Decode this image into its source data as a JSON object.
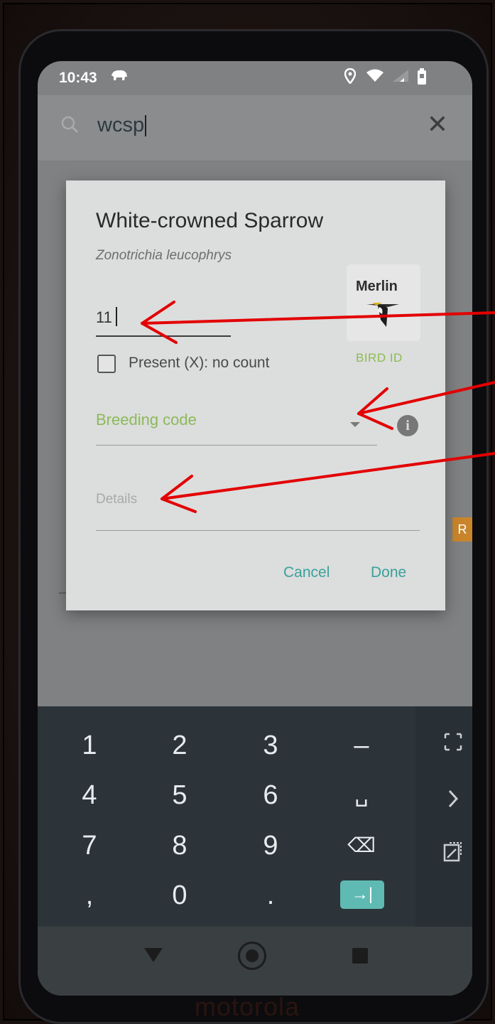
{
  "status_bar": {
    "time": "10:43"
  },
  "search": {
    "query": "wcsp"
  },
  "dialog": {
    "common_name": "White-crowned Sparrow",
    "scientific_name": "Zonotrichia leucophrys",
    "count_value": "11",
    "present_label": "Present (X): no count",
    "breeding_code_label": "Breeding code",
    "details_placeholder": "Details",
    "merlin_logo_text": "Merlin",
    "merlin_link_label": "BIRD ID",
    "cancel_label": "Cancel",
    "done_label": "Done"
  },
  "keyboard": {
    "rows": [
      [
        "1",
        "2",
        "3",
        "–"
      ],
      [
        "4",
        "5",
        "6",
        "␣"
      ],
      [
        "7",
        "8",
        "9",
        "⌫"
      ],
      [
        ",",
        "0",
        ".",
        "→|"
      ]
    ]
  },
  "device": {
    "brand": "motorola"
  },
  "colors": {
    "accent_teal": "#3aa19a",
    "breeding_green": "#8cba5a",
    "annotation_red": "#e30000"
  }
}
